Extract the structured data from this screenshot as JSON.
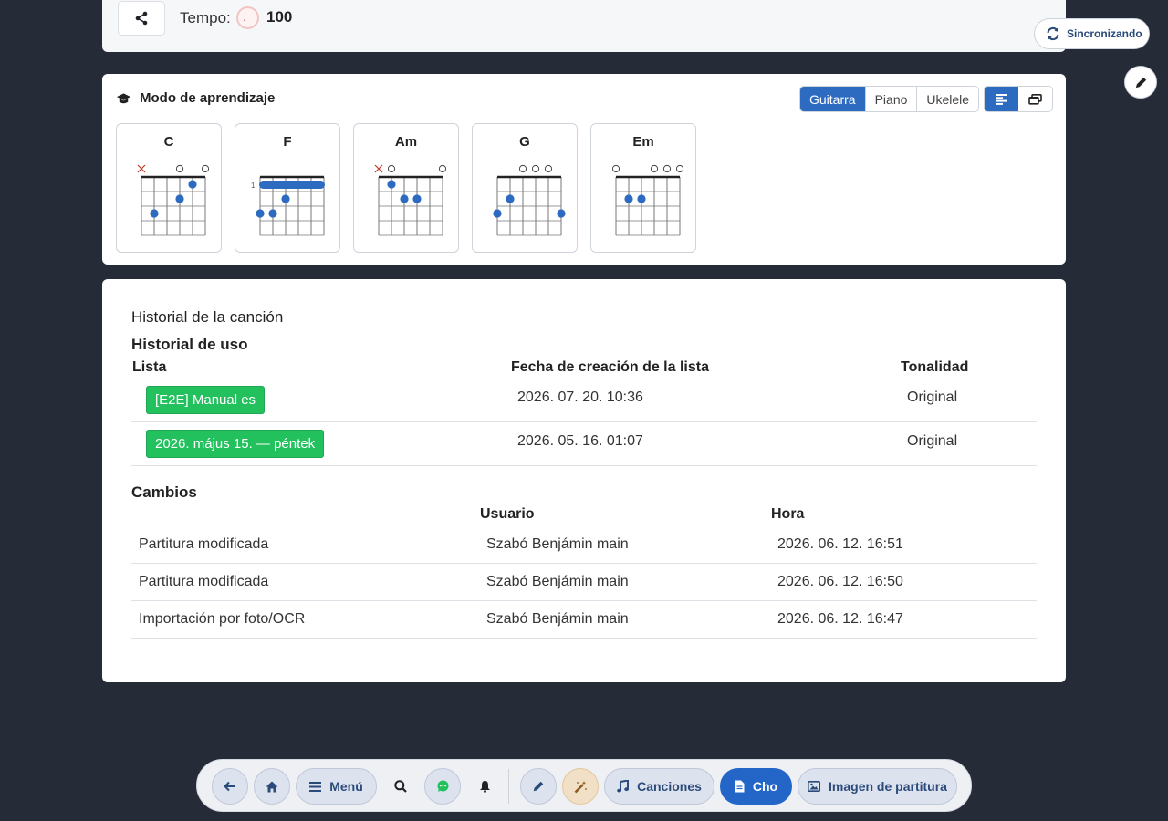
{
  "header": {
    "tempo_label": "Tempo:",
    "tempo_icon": "♩",
    "tempo_value": "100",
    "share_icon": "share-icon"
  },
  "sync": {
    "label": "Sincronizando",
    "icon": "sync-icon"
  },
  "learning": {
    "title": "Modo de aprendizaje",
    "icon": "graduation-cap-icon",
    "instruments": [
      "Guitarra",
      "Piano",
      "Ukelele"
    ],
    "active_instrument": "Guitarra",
    "views": [
      "text-view-icon",
      "cards-view-icon"
    ],
    "chords": [
      {
        "name": "C",
        "markers": [
          "x",
          "",
          "",
          "o",
          "",
          "o"
        ],
        "dots": [
          [
            5,
            1
          ],
          [
            4,
            2
          ],
          [
            2,
            3
          ]
        ],
        "barre": null
      },
      {
        "name": "F",
        "markers": [
          "",
          "",
          "",
          "",
          "",
          ""
        ],
        "fret_label": "1",
        "dots": [
          [
            3,
            2
          ],
          [
            2,
            3
          ],
          [
            1,
            3
          ]
        ],
        "barre": 1
      },
      {
        "name": "Am",
        "markers": [
          "x",
          "o",
          "",
          "",
          "",
          "o"
        ],
        "dots": [
          [
            2,
            1
          ],
          [
            3,
            2
          ],
          [
            4,
            2
          ]
        ],
        "barre": null
      },
      {
        "name": "G",
        "markers": [
          "",
          "",
          "o",
          "o",
          "o",
          ""
        ],
        "dots": [
          [
            1,
            3
          ],
          [
            2,
            2
          ],
          [
            6,
            3
          ]
        ],
        "barre": null
      },
      {
        "name": "Em",
        "markers": [
          "o",
          "",
          "",
          "o",
          "o",
          "o"
        ],
        "dots": [
          [
            2,
            2
          ],
          [
            3,
            2
          ]
        ],
        "barre": null
      }
    ]
  },
  "history": {
    "title": "Historial de la canción",
    "usage_title": "Historial de uso",
    "usage_headers": {
      "list": "Lista",
      "date": "Fecha de creación de la lista",
      "key": "Tonalidad"
    },
    "usage_rows": [
      {
        "list": "[E2E] Manual es",
        "date": "2026. 07. 20. 10:36",
        "key": "Original"
      },
      {
        "list": "2026. május 15. — péntek",
        "date": "2026. 05. 16. 01:07",
        "key": "Original"
      }
    ],
    "changes_title": "Cambios",
    "changes_headers": {
      "user": "Usuario",
      "time": "Hora"
    },
    "changes_rows": [
      {
        "change": "Partitura modificada",
        "user": "Szabó Benjámin main",
        "time": "2026. 06. 12. 16:51"
      },
      {
        "change": "Partitura modificada",
        "user": "Szabó Benjámin main",
        "time": "2026. 06. 12. 16:50"
      },
      {
        "change": "Importación por foto/OCR",
        "user": "Szabó Benjámin main",
        "time": "2026. 06. 12. 16:47"
      }
    ]
  },
  "nav": {
    "menu_label": "Menú",
    "songs_label": "Canciones",
    "cho_label": "Cho",
    "sheet_label": "Imagen de partitura"
  },
  "colors": {
    "primary": "#2366c8",
    "badge_green": "#22c15e",
    "background": "#262b38"
  }
}
